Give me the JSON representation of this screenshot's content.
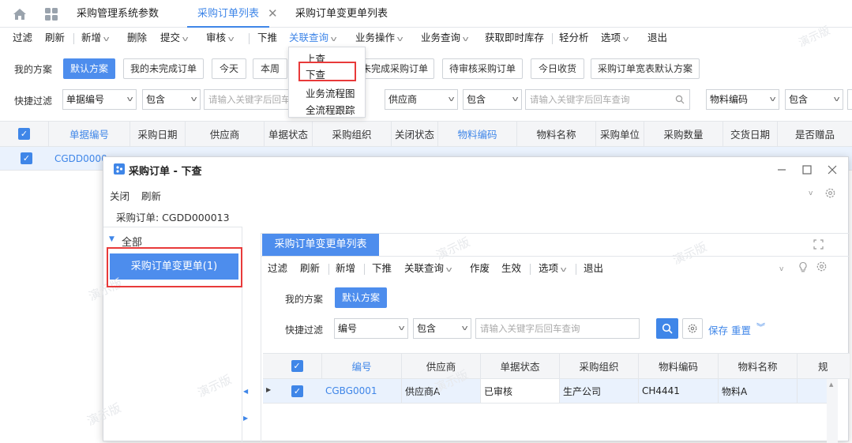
{
  "tabbar": {
    "tabs": [
      "采购管理系统参数",
      "采购订单列表",
      "采购订单变更单列表"
    ],
    "close_glyph": "✕"
  },
  "menubar": {
    "items": [
      "过滤",
      "刷新",
      "新增",
      "删除",
      "提交",
      "审核",
      "下推",
      "关联查询",
      "业务操作",
      "业务查询",
      "获取即时库存",
      "轻分析",
      "选项",
      "退出"
    ],
    "watermark": "演示版"
  },
  "dropdown": {
    "items": [
      "上查",
      "下查",
      "业务流程图",
      "全流程跟踪"
    ]
  },
  "scheme": {
    "label": "我的方案",
    "buttons": [
      "默认方案",
      "我的未完成订单",
      "今天",
      "本周",
      "本月未完成采购订单",
      "待审核采购订单",
      "今日收货",
      "采购订单宽表默认方案"
    ]
  },
  "quickfilter": {
    "label": "快捷过滤",
    "groups": [
      {
        "field": "单据编号",
        "op": "包含",
        "placeholder": "请输入关键字后回车查询"
      },
      {
        "field": "供应商",
        "op": "包含",
        "placeholder": "请输入关键字后回车查询"
      },
      {
        "field": "物料编码",
        "op": "包含",
        "placeholder": ""
      }
    ]
  },
  "main_table": {
    "headers": [
      "单据编号",
      "采购日期",
      "供应商",
      "单据状态",
      "采购组织",
      "关闭状态",
      "物料编码",
      "物料名称",
      "采购单位",
      "采购数量",
      "交货日期",
      "是否赠品"
    ],
    "row": {
      "bill_no": "CGDD0000"
    }
  },
  "dialog": {
    "title": "采购订单 - 下查",
    "toolbar": [
      "关闭",
      "刷新"
    ],
    "subtitle": "采购订单: CGDD000013",
    "tree": {
      "root": "全部",
      "node": "采购订单变更单(1)"
    },
    "inner_tab": "采购订单变更单列表",
    "inner_menu": [
      "过滤",
      "刷新",
      "新增",
      "下推",
      "关联查询",
      "作废",
      "生效",
      "选项",
      "退出"
    ],
    "scheme_label": "我的方案",
    "scheme_button": "默认方案",
    "filter_label": "快捷过滤",
    "filter_field": "编号",
    "filter_op": "包含",
    "filter_placeholder": "请输入关键字后回车查询",
    "save_label": "保存",
    "reset_label": "重置",
    "table": {
      "headers": [
        "编号",
        "供应商",
        "单据状态",
        "采购组织",
        "物料编码",
        "物料名称",
        "规"
      ],
      "row": [
        "CGBG0001",
        "供应商A",
        "已审核",
        "生产公司",
        "CH4441",
        "物料A"
      ]
    },
    "watermark": "演示版"
  },
  "colors": {
    "accent": "#3f86e8",
    "highlight": "#e83a3a",
    "primary_button": "#4d8ded"
  }
}
